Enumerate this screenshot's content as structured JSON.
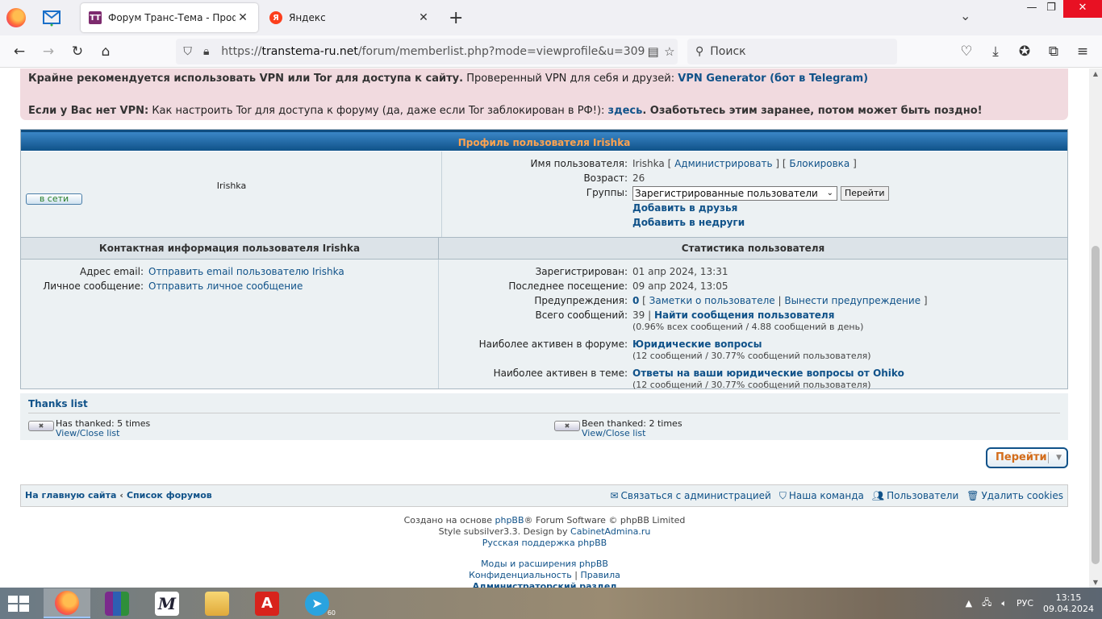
{
  "browser": {
    "tabs": [
      {
        "title": "Форум Транс-Тема - Профиль",
        "favicon": "ТТ",
        "active": true
      },
      {
        "title": "Яндекс",
        "favicon": "Я",
        "active": false
      }
    ],
    "url_prefix": "https://",
    "url_domain": "transtema-ru.net",
    "url_path": "/forum/memberlist.php?mode=viewprofile&u=309",
    "search_placeholder": "Поиск"
  },
  "alert": {
    "line1_bold": "Крайне рекомендуется использовать VPN или Tor для доступа к сайту.",
    "line1_text": " Проверенный VPN для себя и друзей: ",
    "line1_link": "VPN Generator (бот в Telegram)",
    "line2_bold": "Если у Вас нет VPN:",
    "line2_text": " Как настроить Tor для доступа к форуму (да, даже если Tor заблокирован в РФ!): ",
    "line2_link": "здесь",
    "line2_end": ". Озаботьтесь этим заранее, потом может быть поздно!"
  },
  "profile": {
    "header": "Профиль пользователя Irishka",
    "username": "Irishka",
    "online_label": "в сети",
    "fields": {
      "name_label": "Имя пользователя:",
      "name_value": "Irishka",
      "admin_link": "Администрировать",
      "ban_link": "Блокировка",
      "age_label": "Возраст:",
      "age_value": "26",
      "groups_label": "Группы:",
      "groups_selected": "Зарегистрированные пользователи",
      "groups_go": "Перейти",
      "add_friend": "Добавить в друзья",
      "add_foe": "Добавить в недруги"
    }
  },
  "contact": {
    "header": "Контактная информация пользователя Irishka",
    "email_label": "Адрес email:",
    "email_link": "Отправить email пользователю Irishka",
    "pm_label": "Личное сообщение:",
    "pm_link": "Отправить личное сообщение"
  },
  "stats": {
    "header": "Статистика пользователя",
    "registered_label": "Зарегистрирован:",
    "registered_value": "01 апр 2024, 13:31",
    "last_visit_label": "Последнее посещение:",
    "last_visit_value": "09 апр 2024, 13:05",
    "warnings_label": "Предупреждения:",
    "warnings_value": "0",
    "notes_link": "Заметки о пользователе",
    "remove_warn_link": "Вынести предупреждение",
    "posts_label": "Всего сообщений:",
    "posts_value": "39",
    "find_posts_link": "Найти сообщения пользователя",
    "posts_sub": "(0.96% всех сообщений / 4.88 сообщений в день)",
    "active_forum_label": "Наиболее активен в форуме:",
    "active_forum_link": "Юридические вопросы",
    "active_forum_sub": "(12 сообщений / 30.77% сообщений пользователя)",
    "active_topic_label": "Наиболее активен в теме:",
    "active_topic_link": "Ответы на ваши юридические вопросы от Ohiko",
    "active_topic_sub": "(12 сообщений / 30.77% сообщений пользователя)"
  },
  "thanks": {
    "title": "Thanks list",
    "has_thanked": "Has thanked: 5 times",
    "been_thanked": "Been thanked: 2 times",
    "view_close": "View/Close list"
  },
  "jump": {
    "label": "Перейти"
  },
  "footer_nav": {
    "home": "На главную сайта",
    "forums": "Список форумов",
    "contact": "Связаться с администрацией",
    "team": "Наша команда",
    "members": "Пользователи",
    "cookies": "Удалить cookies"
  },
  "copyright": {
    "line1_pre": "Создано на основе ",
    "line1_link": "phpBB",
    "line1_post": "® Forum Software © phpBB Limited",
    "line2_pre": "Style subsilver3.3. Design by ",
    "line2_link": "CabinetAdmina.ru",
    "line3": "Русская поддержка phpBB",
    "line4": "Моды и расширения phpBB",
    "privacy": "Конфиденциальность",
    "sep": "|",
    "terms": "Правила",
    "admin": "Администраторский раздел"
  },
  "taskbar": {
    "lang": "РУС",
    "time": "13:15",
    "date": "09.04.2024",
    "telegram_badge": "60"
  },
  "colors": {
    "link": "#105289",
    "alert_bg": "#f1dadf",
    "header_bg": "#105289",
    "header_text": "#ffa34f"
  }
}
